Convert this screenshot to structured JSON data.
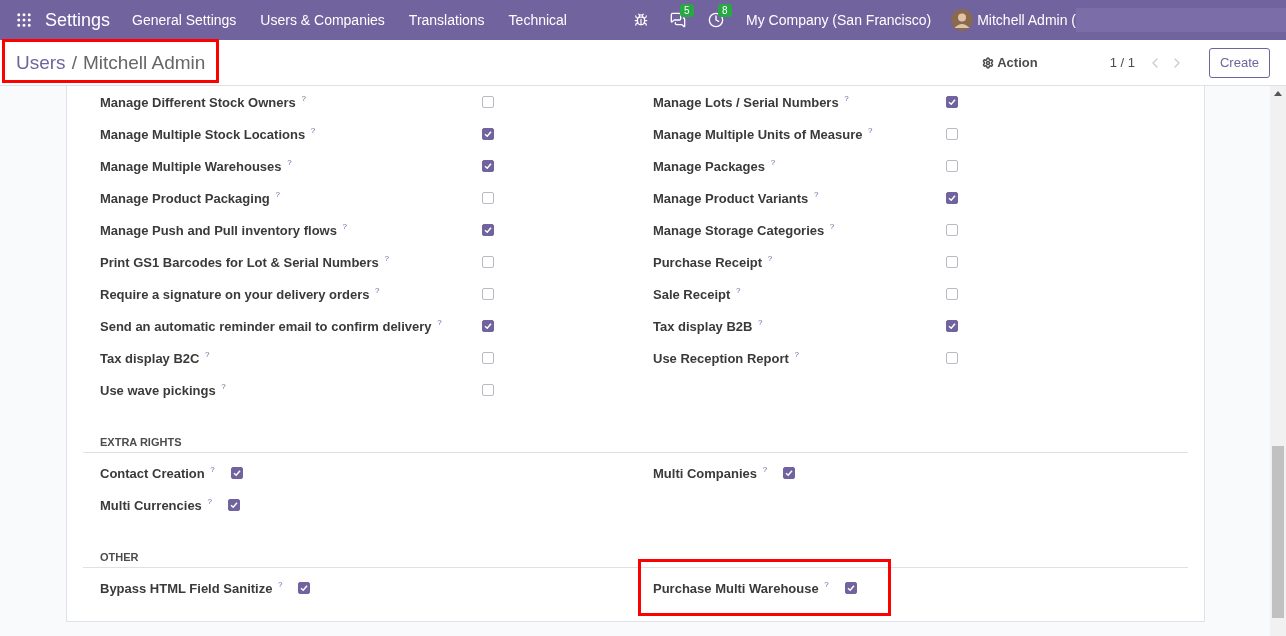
{
  "navbar": {
    "app_title": "Settings",
    "menu": [
      "General Settings",
      "Users & Companies",
      "Translations",
      "Technical"
    ],
    "messages_count": "5",
    "activities_count": "8",
    "company": "My Company (San Francisco)",
    "user": "Mitchell Admin ("
  },
  "control_panel": {
    "breadcrumb": [
      "Users",
      "Mitchell Admin"
    ],
    "breadcrumb_separator": "/",
    "breadcrumb_highlighted": true,
    "action": "Action",
    "pager": "1 / 1",
    "create": "Create"
  },
  "sections": [
    {
      "kind": "table",
      "items": [
        {
          "label": "Manage Different Stock Owners $^{?}$",
          "checked": false,
          "highlighted": false
        },
        {
          "label": "Manage Lots / Serial Numbers $^{?}$",
          "checked": true,
          "highlighted": false
        },
        {
          "label": "Manage Multiple Stock Locations $^{?}$",
          "checked": true,
          "highlighted": false
        },
        {
          "label": "Manage Multiple Units of Measure $^{?}$",
          "checked": false,
          "highlighted": false
        },
        {
          "label": "Manage Multiple Warehouses $^{?}$",
          "checked": true,
          "highlighted": false
        },
        {
          "label": "Manage Packages $^{?}$",
          "checked": false,
          "highlighted": false
        },
        {
          "label": "Manage Product Packaging $^{?}$",
          "checked": false,
          "highlighted": false
        },
        {
          "label": "Manage Product Variants $^{?}$",
          "checked": true,
          "highlighted": false
        },
        {
          "label": "Manage Push and Pull inventory flows $^{?}$",
          "checked": true,
          "highlighted": false
        },
        {
          "label": "Manage Storage Categories $^{?}$",
          "checked": false,
          "highlighted": false
        },
        {
          "label": "Print GS1 Barcodes for Lot & Serial Numbers $^{?}$",
          "checked": false,
          "highlighted": false
        },
        {
          "label": "Purchase Receipt $^{?}$",
          "checked": false,
          "highlighted": false
        },
        {
          "label": "Require a signature on your delivery orders $^{?}$",
          "checked": false,
          "highlighted": false
        },
        {
          "label": "Sale Receipt $^{?}$",
          "checked": false,
          "highlighted": false
        },
        {
          "label": "Send an automatic reminder email to confirm delivery $^{?}$",
          "checked": true,
          "highlighted": false
        },
        {
          "label": "Tax display B2B $^{?}$",
          "checked": true,
          "highlighted": false
        },
        {
          "label": "Tax display B2C $^{?}$",
          "checked": false,
          "highlighted": false
        },
        {
          "label": "Use Reception Report $^{?}$",
          "checked": false,
          "highlighted": false
        },
        {
          "label": "Use wave pickings $^{?}$",
          "checked": false,
          "highlighted": false
        }
      ]
    },
    {
      "title": "EXTRA RIGHTS",
      "kind": "inline",
      "items": [
        {
          "label": "Contact Creation $^{?}$",
          "checked": true,
          "highlighted": false
        },
        {
          "label": "Multi Companies $^{?}$",
          "checked": true,
          "highlighted": false
        },
        {
          "label": "Multi Currencies $^{?}$",
          "checked": true,
          "highlighted": false
        }
      ]
    },
    {
      "title": "OTHER",
      "kind": "inline",
      "items": [
        {
          "label": "Bypass HTML Field Sanitize $^{?}$",
          "checked": true,
          "highlighted": false
        },
        {
          "label": "Purchase Multi Warehouse $^{?}$",
          "checked": true,
          "highlighted": true
        }
      ]
    }
  ]
}
